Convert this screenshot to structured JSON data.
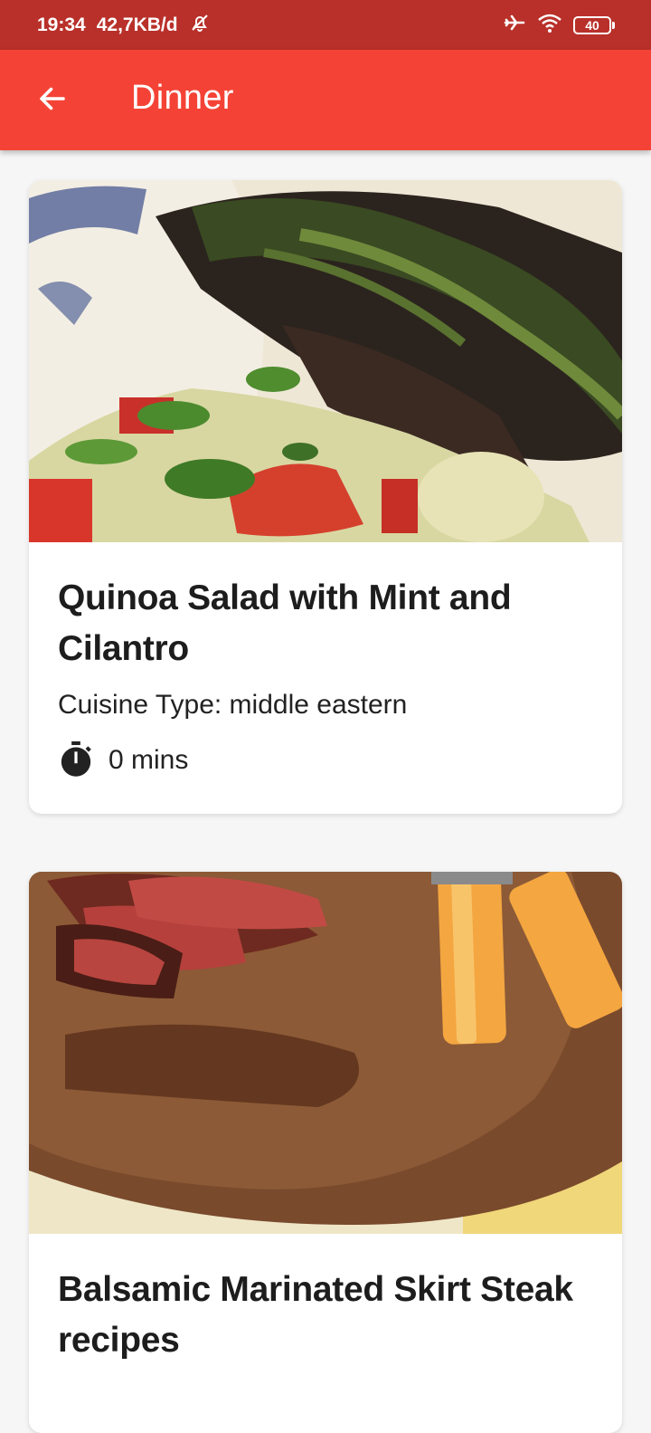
{
  "status_bar": {
    "time": "19:34",
    "network_speed": "42,7KB/d",
    "battery_level": "40",
    "icons": [
      "mute-notification-icon",
      "airplane-icon",
      "wifi-icon",
      "battery-icon"
    ]
  },
  "app_bar": {
    "title": "Dinner",
    "back_icon": "arrow-back-icon",
    "background": "#f44336"
  },
  "recipes": [
    {
      "title": "Quinoa Salad with Mint and Cilantro",
      "cuisine": "Cuisine Type: middle eastern",
      "time": "0 mins",
      "image": "quinoa-salad-with-grilled-meat-photo"
    },
    {
      "title": "Balsamic Marinated Skirt Steak recipes",
      "image": "sliced-skirt-steak-on-wooden-board-photo"
    }
  ]
}
